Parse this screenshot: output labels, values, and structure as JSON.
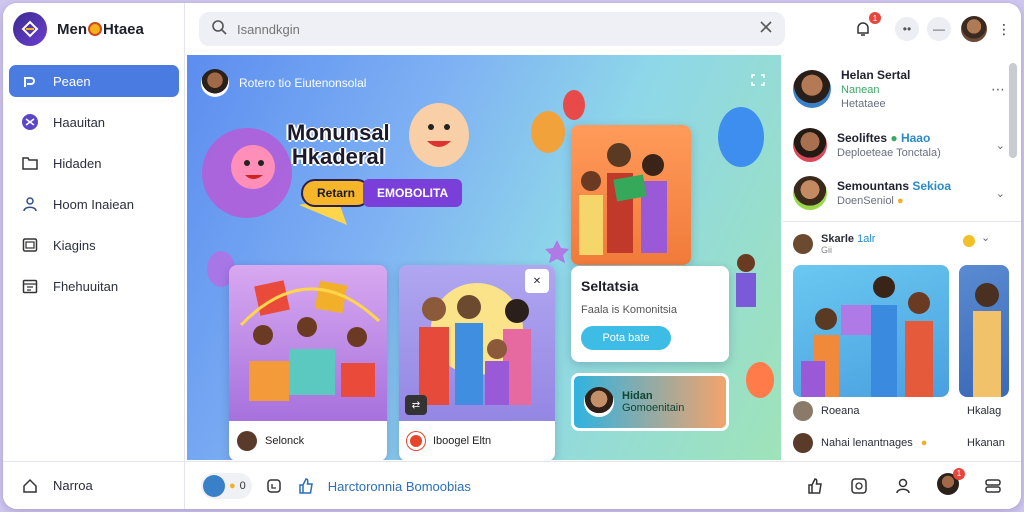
{
  "app": {
    "name_part1": "Men",
    "name_part2": "Htaea",
    "logo_icon": "brand-logo-icon"
  },
  "colors": {
    "accent": "#4a7be0",
    "badge": "#e8453c",
    "brand_dark": "#3b2a8f"
  },
  "sidebar": {
    "items": [
      {
        "label": "Peaen",
        "icon": "home-icon",
        "active": true
      },
      {
        "label": "Haauitan",
        "icon": "compass-icon",
        "active": false
      },
      {
        "label": "Hidaden",
        "icon": "folder-icon",
        "active": false
      },
      {
        "label": "Hoom Inaiean",
        "icon": "user-icon",
        "active": false
      },
      {
        "label": "Kiagins",
        "icon": "window-icon",
        "active": false
      },
      {
        "label": "Fhehuuitan",
        "icon": "calendar-icon",
        "active": false
      }
    ],
    "footer_label": "Narroa"
  },
  "search": {
    "placeholder": "Isanndkgin"
  },
  "topbar": {
    "notification_count": "1"
  },
  "hero": {
    "author": "Rotero tio Eiutenonsolal",
    "title_line1": "Monunsal",
    "title_line2": "Hkaderal",
    "cta_primary": "Retarn",
    "cta_secondary": "EMOBOLITA",
    "card1_caption": "Selonck",
    "card2_caption": "Iboogel Eltn",
    "info_title": "Seltatsia",
    "info_subtitle": "Faala is Komonitsia",
    "info_button": "Pota bate",
    "chip_line1": "Hidan",
    "chip_line2": "Gomoenitain"
  },
  "conversations": [
    {
      "name": "Helan Sertal",
      "sub": "Nanean",
      "sub2": "Hetataee"
    },
    {
      "name": "Seoliftes",
      "name_badge": "Haao",
      "sub": "Deploeteae Tonctala)"
    },
    {
      "name": "Semountans",
      "name_badge": "Sekioa",
      "sub": "DoenSeniol"
    }
  ],
  "feed": {
    "author": "Skarle",
    "author_tag": "1alr",
    "author_sub": "Gii",
    "item1_caption": "Roeana",
    "item2_caption": "Hkalag",
    "item3_caption": "Nahai lenantnages",
    "item4_caption": "Hkanan"
  },
  "bottombar": {
    "chip_count": "0",
    "link_text": "Harctoronnia Bomoobias",
    "profile_badge": "1"
  }
}
